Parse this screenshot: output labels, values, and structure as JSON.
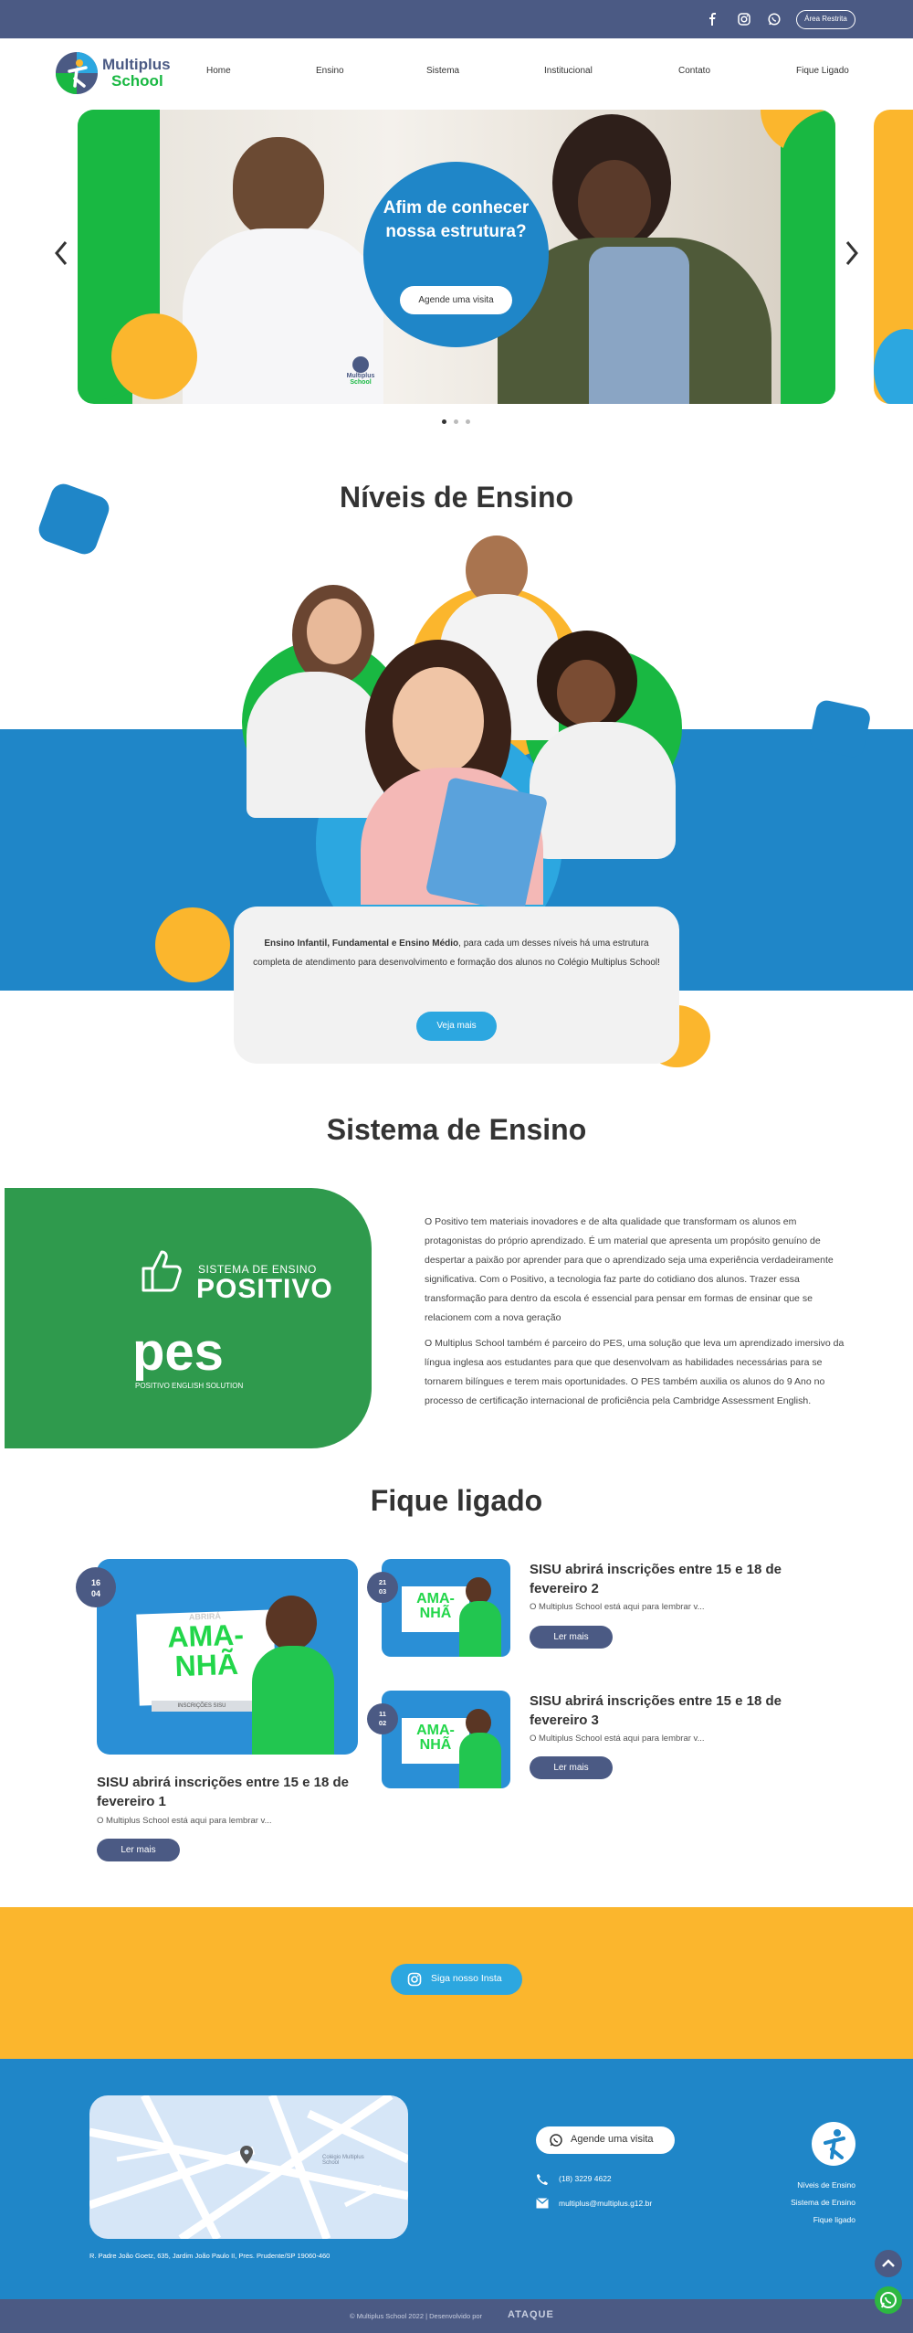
{
  "topbar": {
    "icons": [
      "facebook-icon",
      "instagram-icon",
      "whatsapp-icon"
    ],
    "area_label": "Área Restrita"
  },
  "brand": {
    "name_line1": "Multiplus",
    "name_line2": "School"
  },
  "nav": {
    "items": [
      "Home",
      "Ensino",
      "Sistema",
      "Institucional",
      "Contato",
      "Fique Ligado"
    ]
  },
  "hero": {
    "headline": "Afim de conhecer nossa estrutura?",
    "cta": "Agende uma visita",
    "prev_icon": "chevron-left-icon",
    "next_icon": "chevron-right-icon",
    "dots": 3,
    "shirt_brand_line1": "Multiplus",
    "shirt_brand_line2": "School"
  },
  "niveis": {
    "title": "Níveis de Ensino",
    "text_bold": "Ensino Infantil, Fundamental e Ensino Médio",
    "text_rest": ", para cada um desses níveis há uma estrutura completa de atendimento para desenvolvimento e formação dos alunos no Colégio Multiplus School!",
    "cta": "Veja mais"
  },
  "sistema": {
    "title": "Sistema de Ensino",
    "logo1_small": "SISTEMA DE ENSINO",
    "logo1_big": "POSITIVO",
    "logo2_big": "pes",
    "logo2_small": "POSITIVO ENGLISH SOLUTION",
    "p1": "O Positivo tem materiais inovadores e de alta qualidade que transformam os alunos em protagonistas do próprio aprendizado. É um material que apresenta um propósito genuíno de despertar a paixão por aprender para que o aprendizado seja uma experiência verdadeiramente significativa. Com o Positivo, a tecnologia faz parte do cotidiano dos alunos. Trazer essa transformação para dentro da escola é essencial para pensar em formas de ensinar que se relacionem com a nova geração",
    "p2": "O Multiplus School também é parceiro do PES, uma solução que leva um aprendizado imersivo da língua inglesa aos estudantes para que que desenvolvam as habilidades necessárias para se tornarem bilíngues e terem mais oportunidades. O PES também auxilia os alunos do 9    Ano no processo de certificação internacional de proficiência pela Cambridge Assessment English."
  },
  "fique": {
    "title": "Fique ligado",
    "news": [
      {
        "day": "16",
        "month": "04",
        "title": "SISU abrirá inscrições entre 15 e 18 de fevereiro 1",
        "desc": "O Multiplus School está aqui para lembrar v...",
        "cta": "Ler mais"
      },
      {
        "day": "21",
        "month": "03",
        "title": "SISU abrirá inscrições entre 15 e 18 de fevereiro 2",
        "desc": "O Multiplus School está aqui para lembrar v...",
        "cta": "Ler mais"
      },
      {
        "day": "11",
        "month": "02",
        "title": "SISU abrirá inscrições entre 15 e 18 de fevereiro 3",
        "desc": "O Multiplus School está aqui para lembrar v...",
        "cta": "Ler mais"
      }
    ],
    "thumb": {
      "top": "ABRIRÁ",
      "big1": "AMA-",
      "big2": "NHÃ",
      "tag": "INSCRIÇÕES SISU"
    }
  },
  "insta": {
    "label": "Siga nosso Insta"
  },
  "footer": {
    "address": "R. Padre João Goetz, 635, Jardim João Paulo II, Pres. Prudente/SP 19060-460",
    "visit_btn": "Agende uma visita",
    "phone": "(18) 3229 4622",
    "email": "multiplus@multiplus.g12.br",
    "links": [
      "Níveis de Ensino",
      "Sistema de Ensino",
      "Fique ligado"
    ],
    "map_label": "Colégio Multiplus School",
    "copyright": "© Multiplus School 2022 | Desenvolvido por",
    "dev_logo": "ATAQUE"
  },
  "colors": {
    "navy": "#4b5a84",
    "blue": "#1f86c8",
    "sky": "#2ca7e0",
    "green": "#19b842",
    "yellow": "#fbb62d",
    "dark_green": "#2f9a4d"
  }
}
